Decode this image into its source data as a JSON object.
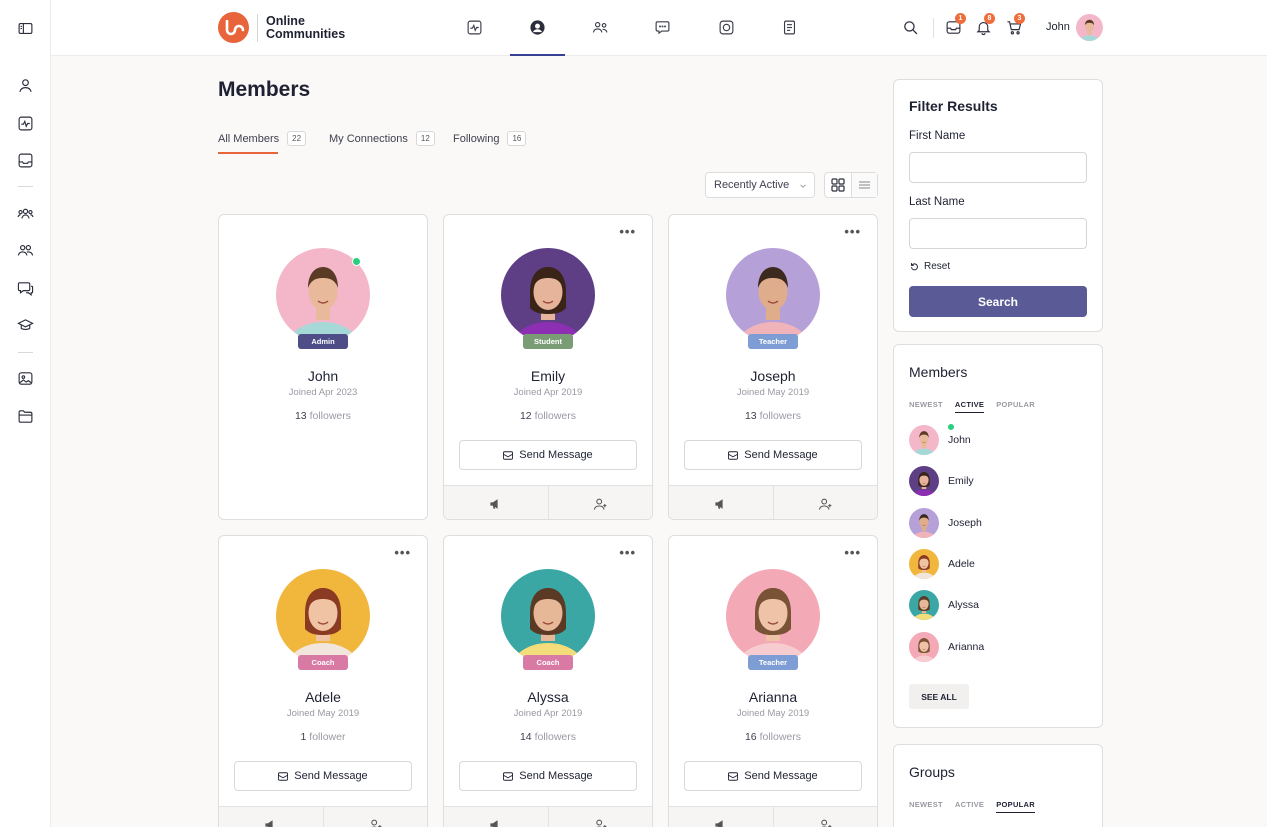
{
  "header": {
    "brand_line1": "Online",
    "brand_line2": "Communities",
    "user_name": "John",
    "badges": {
      "messages": "1",
      "notifications": "8",
      "cart": "3"
    }
  },
  "page": {
    "title": "Members",
    "tabs": [
      {
        "label": "All Members",
        "count": "22"
      },
      {
        "label": "My Connections",
        "count": "12"
      },
      {
        "label": "Following",
        "count": "16"
      }
    ],
    "sort": "Recently Active"
  },
  "members": [
    {
      "name": "John",
      "role": "Admin",
      "role_color": "#4e4d88",
      "joined": "Joined Apr 2023",
      "followers_num": "13",
      "followers_word": "followers",
      "send": "",
      "bg": "#f4b7c9",
      "shirt": "#a7d8d8",
      "hair": "#5b3a26",
      "skin": "#e8b99a"
    },
    {
      "name": "Emily",
      "role": "Student",
      "role_color": "#7a9c74",
      "joined": "Joined Apr 2019",
      "followers_num": "12",
      "followers_word": "followers",
      "send": "Send Message",
      "bg": "#5e3f86",
      "shirt": "#8c2fb3",
      "hair": "#3a2418",
      "skin": "#e6b39b"
    },
    {
      "name": "Joseph",
      "role": "Teacher",
      "role_color": "#7d9dd4",
      "joined": "Joined May 2019",
      "followers_num": "13",
      "followers_word": "followers",
      "send": "Send Message",
      "bg": "#b6a0d8",
      "shirt": "#f0b3b9",
      "hair": "#3d2a1f",
      "skin": "#e0ad8c"
    },
    {
      "name": "Adele",
      "role": "Coach",
      "role_color": "#d97aa5",
      "joined": "Joined May 2019",
      "followers_num": "1",
      "followers_word": "follower",
      "send": "Send Message",
      "bg": "#f1b73c",
      "shirt": "#f1e5dc",
      "hair": "#8a3b22",
      "skin": "#f0c3a5"
    },
    {
      "name": "Alyssa",
      "role": "Coach",
      "role_color": "#d97aa5",
      "joined": "Joined Apr 2019",
      "followers_num": "14",
      "followers_word": "followers",
      "send": "Send Message",
      "bg": "#3aa7a5",
      "shirt": "#f3dc7a",
      "hair": "#5a3a25",
      "skin": "#e6b898"
    },
    {
      "name": "Arianna",
      "role": "Teacher",
      "role_color": "#7d9dd4",
      "joined": "Joined May 2019",
      "followers_num": "16",
      "followers_word": "followers",
      "send": "Send Message",
      "bg": "#f4a9b6",
      "shirt": "#f7ccd0",
      "hair": "#7a5235",
      "skin": "#efc3a7"
    }
  ],
  "filter": {
    "title": "Filter Results",
    "first_name_label": "First Name",
    "last_name_label": "Last Name",
    "reset_label": "Reset",
    "search_label": "Search"
  },
  "members_widget": {
    "title": "Members",
    "tabs": [
      "NEWEST",
      "ACTIVE",
      "POPULAR"
    ],
    "active_tab": "ACTIVE",
    "list": [
      "John",
      "Emily",
      "Joseph",
      "Adele",
      "Alyssa",
      "Arianna"
    ],
    "see_all": "SEE ALL"
  },
  "groups_widget": {
    "title": "Groups",
    "tabs": [
      "NEWEST",
      "ACTIVE",
      "POPULAR"
    ],
    "active_tab": "POPULAR"
  },
  "colors": {
    "accent": "#e8643b",
    "primary": "#5a5a96",
    "online": "#26d07c"
  }
}
